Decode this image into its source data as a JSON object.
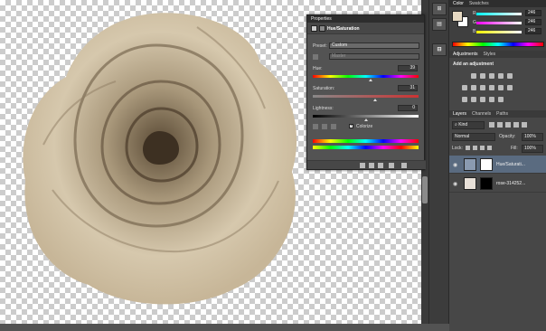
{
  "panels": {
    "color_tabs": [
      "Color",
      "Swatches"
    ],
    "adjustments_tabs": [
      "Adjustments",
      "Styles"
    ],
    "adjustments_title": "Add an adjustment",
    "layers_tabs": [
      "Layers",
      "Channels",
      "Paths"
    ]
  },
  "color": {
    "r_label": "R",
    "r_value": "246",
    "g_label": "G",
    "g_value": "246",
    "b_label": "B",
    "b_value": "246",
    "foreground": "#e6d9c2",
    "background": "#ffffff"
  },
  "properties": {
    "title": "Properties",
    "header": "Hue/Saturation",
    "preset_label": "Preset:",
    "preset_value": "Custom",
    "channel_value": "Master",
    "hue_label": "Hue:",
    "hue_value": "39",
    "saturation_label": "Saturation:",
    "saturation_value": "31",
    "lightness_label": "Lightness:",
    "lightness_value": "0",
    "colorize_label": "Colorize"
  },
  "layers": {
    "kind_value": "Kind",
    "blend_mode": "Normal",
    "opacity_label": "Opacity:",
    "opacity_value": "100%",
    "lock_label": "Lock:",
    "fill_label": "Fill:",
    "fill_value": "100%",
    "items": [
      {
        "name": "Hue/Saturati..."
      },
      {
        "name": "rose-314252..."
      }
    ]
  },
  "dock": {
    "button1": "⊞",
    "button2": "ST"
  },
  "accent": "#5a6b80"
}
